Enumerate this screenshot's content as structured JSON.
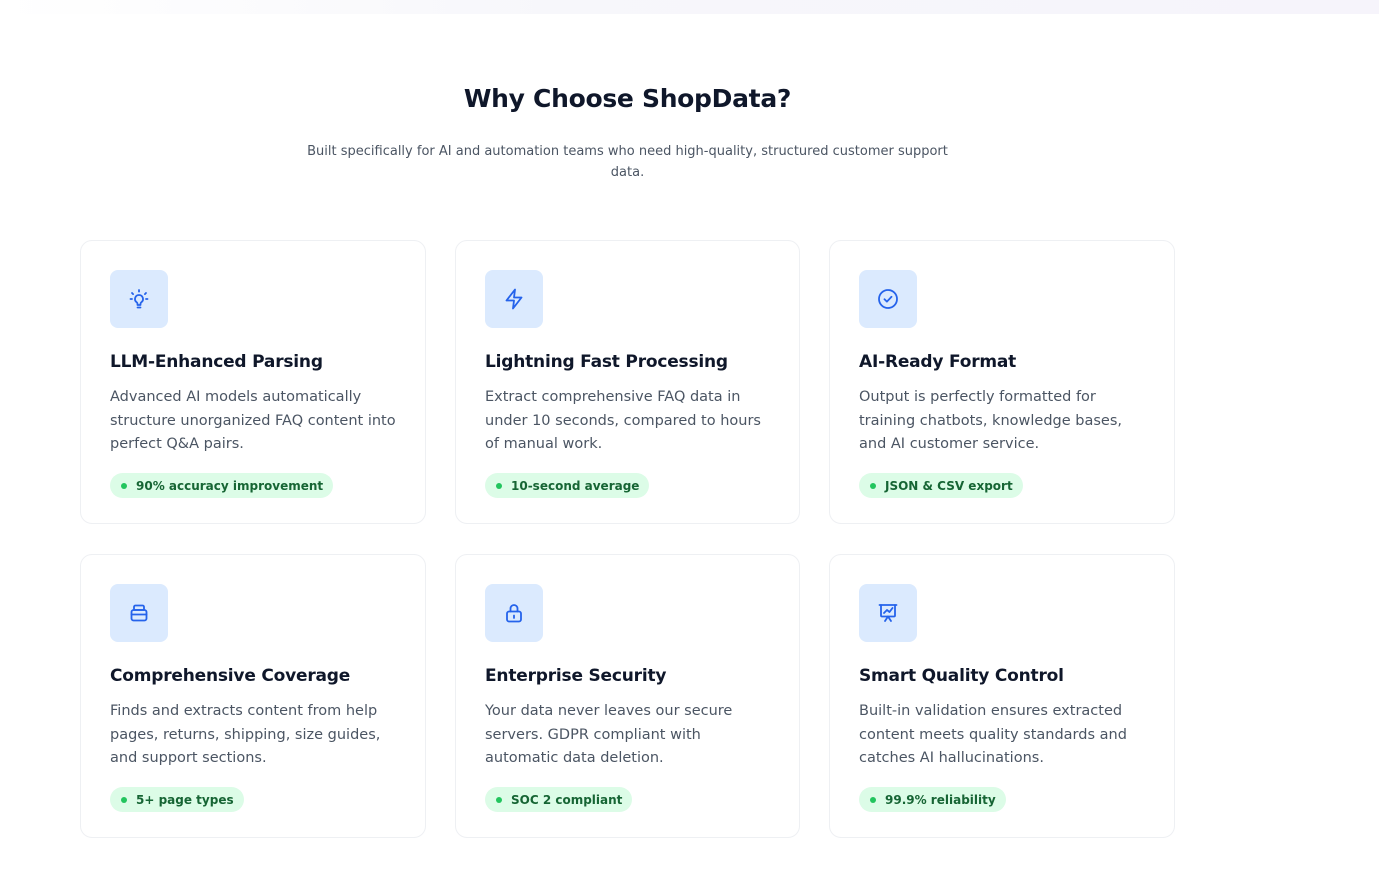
{
  "section": {
    "title": "Why Choose ShopData?",
    "subtitle": "Built specifically for AI and automation teams who need high-quality, structured customer support data."
  },
  "colors": {
    "icon_bg": "#dbeafe",
    "icon_stroke": "#2563eb",
    "badge_bg": "#dcfce7",
    "badge_text": "#166534",
    "badge_dot": "#22c55e"
  },
  "features": [
    {
      "icon": "lightbulb-icon",
      "title": "LLM-Enhanced Parsing",
      "description": "Advanced AI models automatically structure unorganized FAQ content into perfect Q&A pairs.",
      "badge": "90% accuracy improvement"
    },
    {
      "icon": "lightning-icon",
      "title": "Lightning Fast Processing",
      "description": "Extract comprehensive FAQ data in under 10 seconds, compared to hours of manual work.",
      "badge": "10-second average"
    },
    {
      "icon": "check-circle-icon",
      "title": "AI-Ready Format",
      "description": "Output is perfectly formatted for training chatbots, knowledge bases, and AI customer service.",
      "badge": "JSON & CSV export"
    },
    {
      "icon": "archive-icon",
      "title": "Comprehensive Coverage",
      "description": "Finds and extracts content from help pages, returns, shipping, size guides, and support sections.",
      "badge": "5+ page types"
    },
    {
      "icon": "lock-icon",
      "title": "Enterprise Security",
      "description": "Your data never leaves our secure servers. GDPR compliant with automatic data deletion.",
      "badge": "SOC 2 compliant"
    },
    {
      "icon": "presentation-chart-icon",
      "title": "Smart Quality Control",
      "description": "Built-in validation ensures extracted content meets quality standards and catches AI hallucinations.",
      "badge": "99.9% reliability"
    }
  ]
}
